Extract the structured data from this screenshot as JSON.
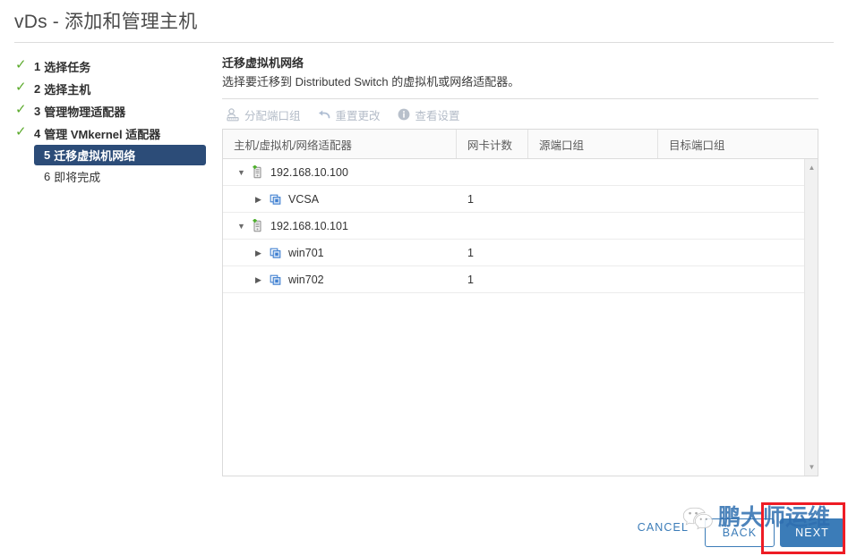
{
  "window": {
    "title": "vDs - 添加和管理主机"
  },
  "steps": [
    {
      "num": "1",
      "label": "选择任务",
      "state": "done"
    },
    {
      "num": "2",
      "label": "选择主机",
      "state": "done"
    },
    {
      "num": "3",
      "label": "管理物理适配器",
      "state": "done"
    },
    {
      "num": "4",
      "label": "管理 VMkernel 适配器",
      "state": "done"
    },
    {
      "num": "5",
      "label": "迁移虚拟机网络",
      "state": "current"
    },
    {
      "num": "6",
      "label": "即将完成",
      "state": "plain"
    }
  ],
  "panel": {
    "heading": "迁移虚拟机网络",
    "description": "选择要迁移到 Distributed Switch 的虚拟机或网络适配器。"
  },
  "toolbar": {
    "items": [
      {
        "label": "分配端口组",
        "icon": "assign-portgroup-icon",
        "enabled": false
      },
      {
        "label": "重置更改",
        "icon": "reset-changes-icon",
        "enabled": false
      },
      {
        "label": "查看设置",
        "icon": "view-settings-icon",
        "enabled": false
      }
    ]
  },
  "table": {
    "columns": [
      "主机/虚拟机/网络适配器",
      "网卡计数",
      "源端口组",
      "目标端口组"
    ],
    "rows": [
      {
        "type": "host",
        "name": "192.168.10.100",
        "nic_count": "",
        "source_pg": "",
        "target_pg": "",
        "expanded": true,
        "icon": "host-add-icon"
      },
      {
        "type": "vm",
        "name": "VCSA",
        "nic_count": "1",
        "source_pg": "",
        "target_pg": "",
        "expanded": false,
        "icon": "virtual-machine-icon"
      },
      {
        "type": "host",
        "name": "192.168.10.101",
        "nic_count": "",
        "source_pg": "",
        "target_pg": "",
        "expanded": true,
        "icon": "host-add-icon"
      },
      {
        "type": "vm",
        "name": "win701",
        "nic_count": "1",
        "source_pg": "",
        "target_pg": "",
        "expanded": false,
        "icon": "virtual-machine-icon"
      },
      {
        "type": "vm",
        "name": "win702",
        "nic_count": "1",
        "source_pg": "",
        "target_pg": "",
        "expanded": false,
        "icon": "virtual-machine-icon"
      }
    ]
  },
  "footer": {
    "cancel_label": "CANCEL",
    "back_label": "BACK",
    "next_label": "NEXT"
  },
  "watermark": {
    "text": "鹏大师运维",
    "logo": "wechat-icon"
  },
  "colors": {
    "accent_blue": "#3b7cb8",
    "step_current_bg": "#2c4c78",
    "check_green": "#5dab2e",
    "annotation_red": "#ee1c25",
    "watermark_blue": "#2f6fb0"
  }
}
